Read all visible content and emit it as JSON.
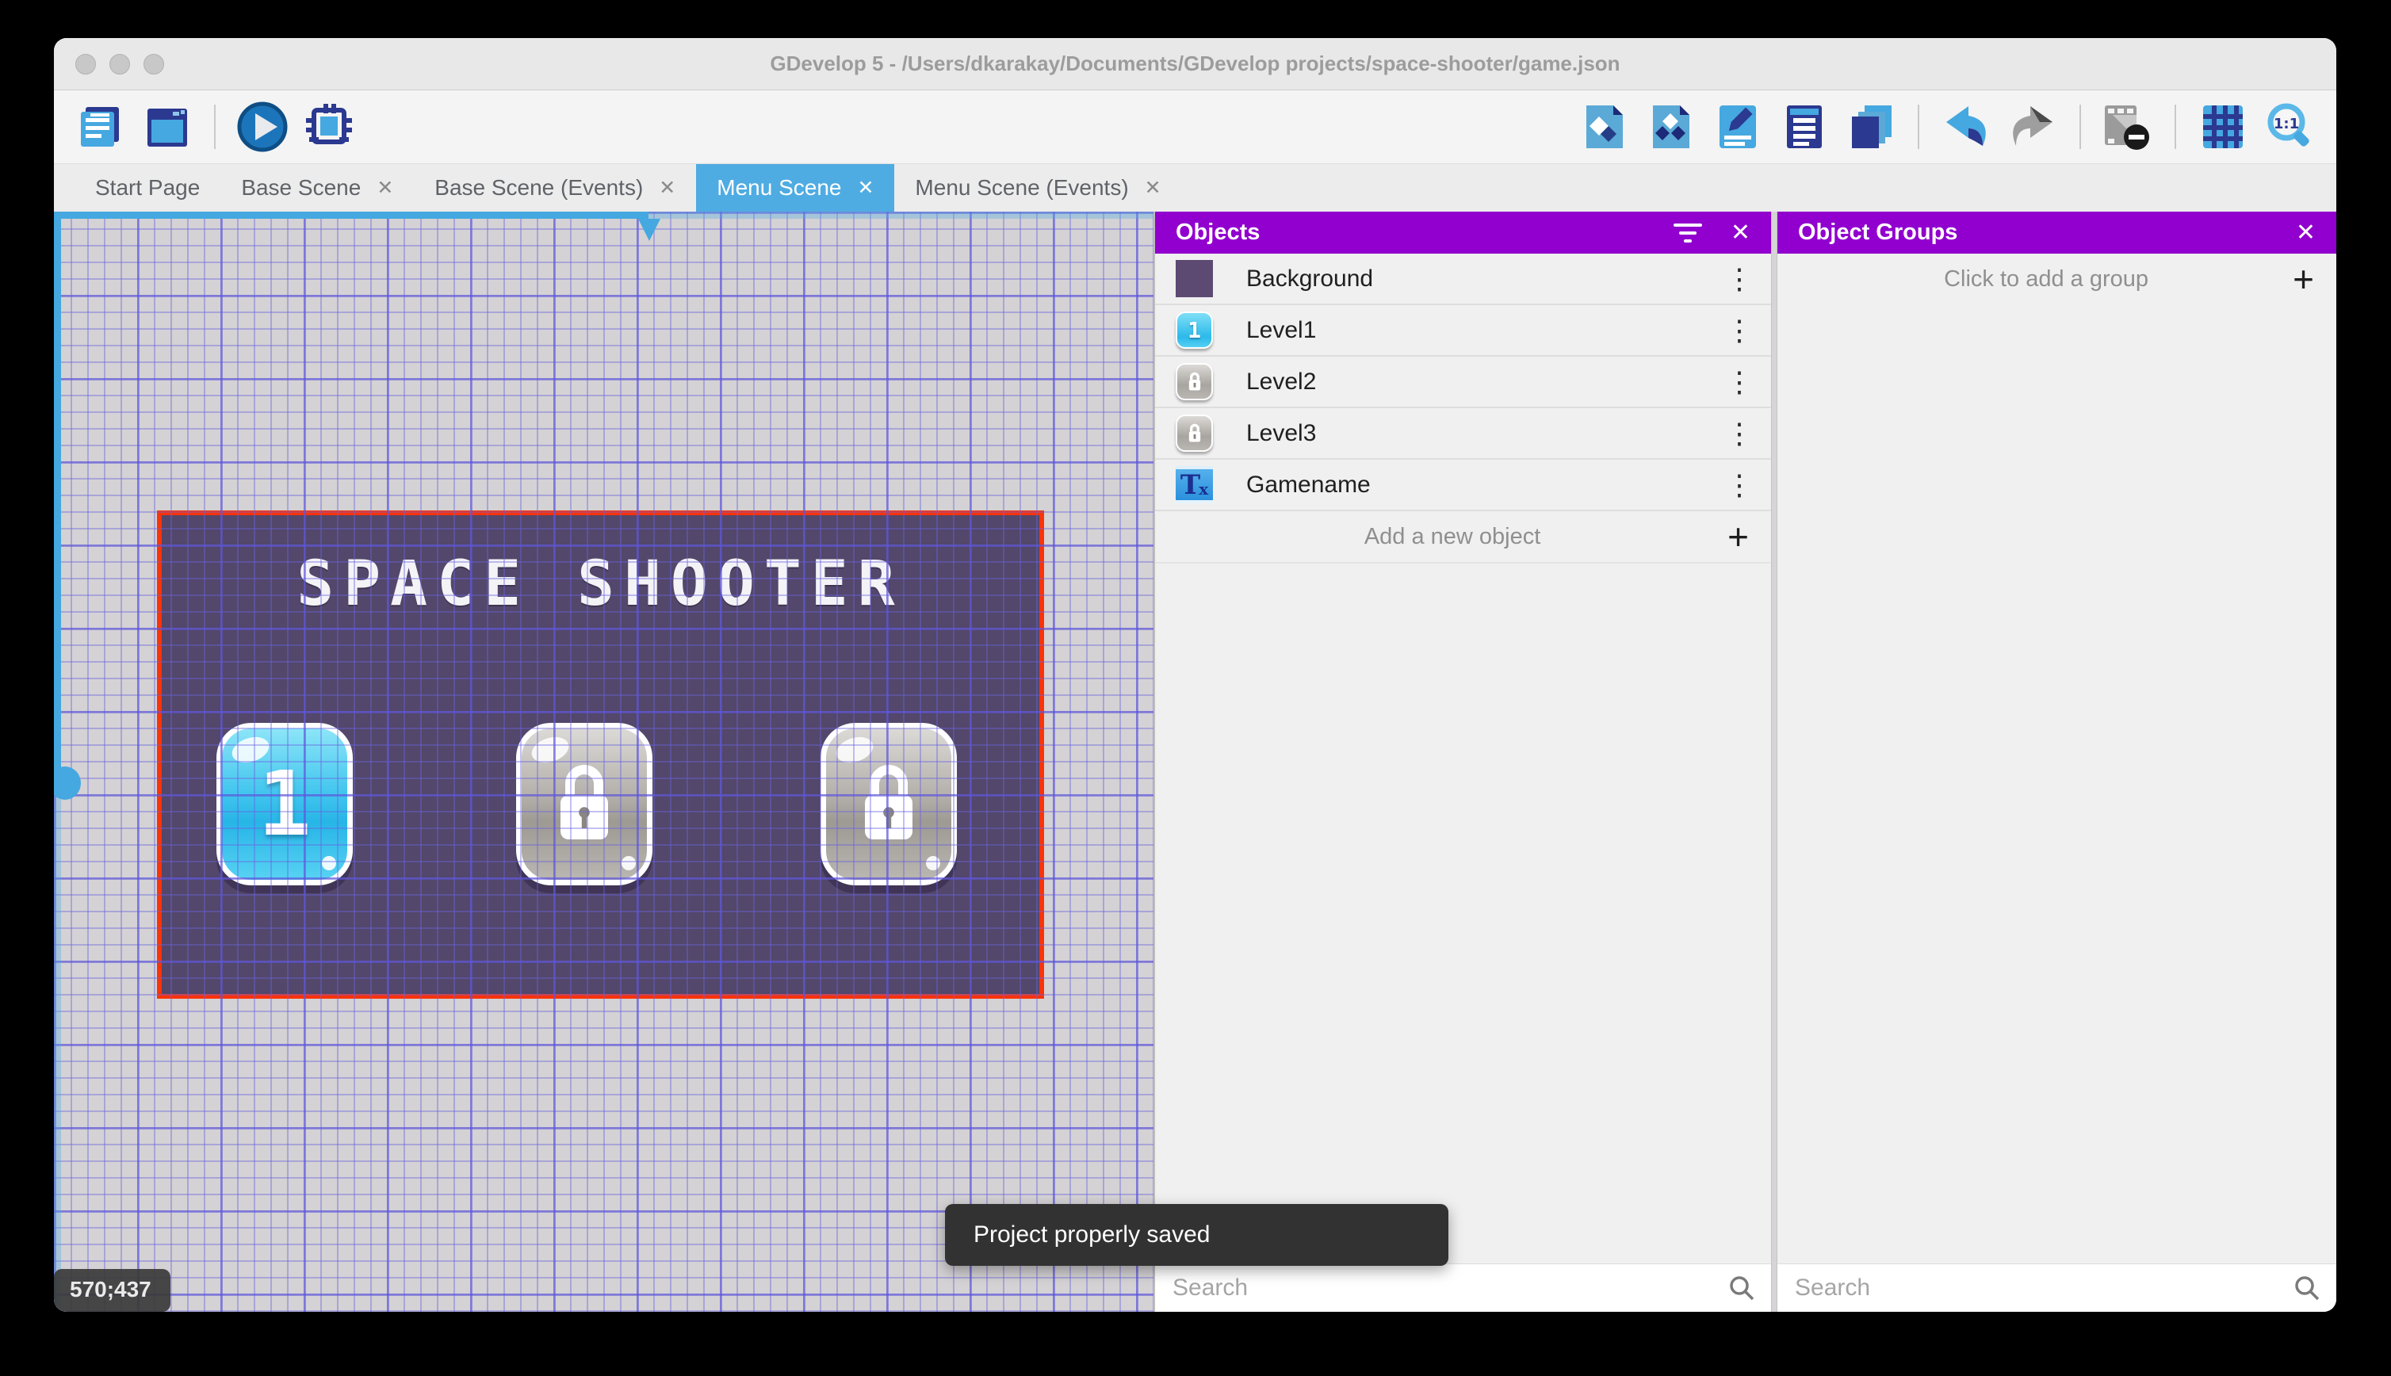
{
  "window": {
    "title": "GDevelop 5 - /Users/dkarakay/Documents/GDevelop projects/space-shooter/game.json"
  },
  "toolbar": {
    "left_icons": [
      "project-manager",
      "scene-editor",
      "preview-play",
      "debug"
    ],
    "right_icons": [
      "add-object",
      "object-groups",
      "edit-properties",
      "instances-list",
      "layers",
      "undo",
      "redo",
      "render-mask",
      "grid",
      "zoom-one-to-one"
    ],
    "zoom_ratio_label": "1:1"
  },
  "tabs": {
    "close_glyph": "✕",
    "items": [
      {
        "label": "Start Page",
        "closable": false,
        "active": false
      },
      {
        "label": "Base Scene",
        "closable": true,
        "active": false
      },
      {
        "label": "Base Scene (Events)",
        "closable": true,
        "active": false
      },
      {
        "label": "Menu Scene",
        "closable": true,
        "active": true
      },
      {
        "label": "Menu Scene (Events)",
        "closable": true,
        "active": false
      }
    ]
  },
  "canvas": {
    "coordinates": "570;437",
    "scene": {
      "title": "SPACE SHOOTER",
      "buttons": [
        {
          "name": "Level1",
          "label": "1",
          "state": "unlocked"
        },
        {
          "name": "Level2",
          "state": "locked"
        },
        {
          "name": "Level3",
          "state": "locked"
        }
      ]
    }
  },
  "objects_panel": {
    "title": "Objects",
    "items": [
      {
        "name": "Background",
        "thumb": "purple-square"
      },
      {
        "name": "Level1",
        "thumb": "blue-button",
        "thumb_label": "1"
      },
      {
        "name": "Level2",
        "thumb": "locked-button"
      },
      {
        "name": "Level3",
        "thumb": "locked-button"
      },
      {
        "name": "Gamename",
        "thumb": "text-object",
        "thumb_label": "T",
        "thumb_sub": "x"
      }
    ],
    "add_label": "Add a new object",
    "search_placeholder": "Search"
  },
  "groups_panel": {
    "title": "Object Groups",
    "empty_label": "Click to add a group",
    "search_placeholder": "Search"
  },
  "toast": {
    "message": "Project properly saved"
  },
  "glyphs": {
    "close": "✕",
    "menu_dots": "⋮",
    "plus": "+"
  },
  "colors": {
    "panel_header_purple": "#9100CE",
    "active_tab_blue": "#4FACE2",
    "selection_red": "#F9330A",
    "scene_fill": "#53476B",
    "toolbar_blue": "#45A8E0",
    "toolbar_navy": "#2B3990"
  }
}
